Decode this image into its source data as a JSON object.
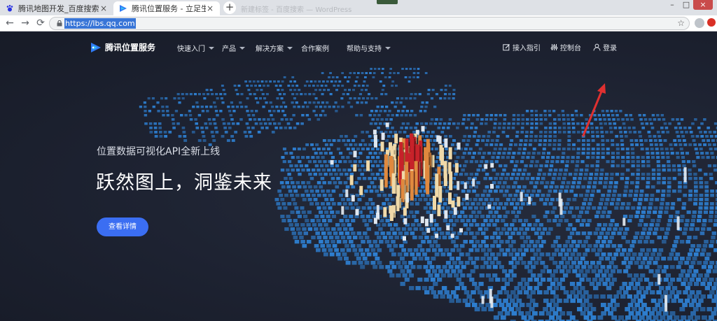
{
  "browser": {
    "tabs": [
      {
        "title": "腾讯地图开发_百度搜索"
      },
      {
        "title": "腾讯位置服务 - 立足生态，连接未来"
      }
    ],
    "ghost_tab": "新建标签 - 百度搜索 — WordPress",
    "new_tab": "+",
    "url": "https://lbs.qq.com",
    "back": "←",
    "forward": "→",
    "reload": "⟳",
    "star": "☆",
    "close": "×",
    "window": {
      "minimize": "–",
      "maximize": "□",
      "close": "×"
    }
  },
  "nav": {
    "brand": "腾讯位置服务",
    "menu": [
      {
        "label": "快速入门",
        "caret": true
      },
      {
        "label": "产品",
        "caret": true
      },
      {
        "label": "解决方案",
        "caret": true
      },
      {
        "label": "合作案例",
        "caret": false
      },
      {
        "label": "帮助与支持",
        "caret": true
      }
    ],
    "right_links": [
      {
        "label": "接入指引",
        "icon": "edit-icon"
      },
      {
        "label": "控制台",
        "icon": "sliders-icon"
      },
      {
        "label": "登录",
        "icon": "user-icon"
      }
    ]
  },
  "hero": {
    "subtitle": "位置数据可视化API全新上线",
    "headline": "跃然图上，洞鉴未来",
    "cta": "查看详情"
  },
  "colors": {
    "accent": "#3b6ef2",
    "grid_blue": "#2e7fd1",
    "bar_cream": "#f0d9a8",
    "bar_orange": "#e0893e",
    "bar_red": "#c7222a",
    "annotation_arrow": "#e03030"
  }
}
